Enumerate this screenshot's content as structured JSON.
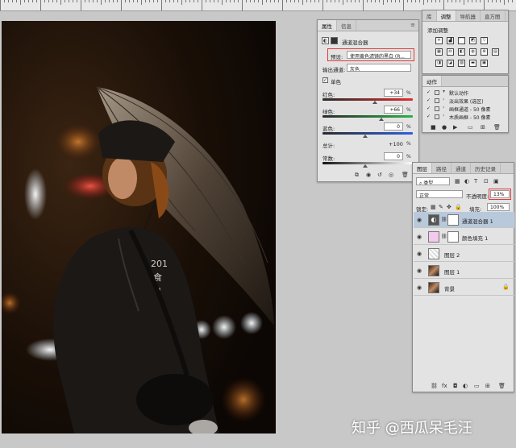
{
  "properties_panel": {
    "tabs": [
      "属性",
      "信息"
    ],
    "title": "通道混合器",
    "preset_label": "预设:",
    "preset_value": "使用黄色滤镜的黑白 (R...",
    "output_channel_label": "输出通道:",
    "output_channel_value": "灰色",
    "monochrome_label": "单色",
    "monochrome_checked": true,
    "red_label": "红色:",
    "red_value": "+34",
    "red_level": 34,
    "green_label": "绿色:",
    "green_value": "+66",
    "green_level": 66,
    "blue_label": "蓝色:",
    "blue_value": "0",
    "blue_level": 0,
    "total_label": "总计:",
    "total_value": "+100",
    "constant_label": "常数:",
    "constant_value": "0",
    "percent": "%",
    "accent_color": "#e23b3b"
  },
  "adjustments_panel": {
    "tabs": [
      "库",
      "调整",
      "导航器",
      "直方图"
    ],
    "add_label": "添加调整"
  },
  "actions_panel": {
    "tab": "动作",
    "rows": [
      {
        "label": "默认动作",
        "checked": true
      },
      {
        "label": "淡出效果 (选区)",
        "checked": true
      },
      {
        "label": "画框通道 - 50 像素",
        "checked": true
      },
      {
        "label": "木质画框 - 50 像素",
        "checked": true
      }
    ]
  },
  "layers_panel": {
    "tabs": [
      "图层",
      "路径",
      "通道",
      "历史记录"
    ],
    "kind_label": "类型",
    "blend_mode": "正常",
    "opacity_label": "不透明度:",
    "opacity_value": "13%",
    "lock_label": "锁定:",
    "fill_label": "填充:",
    "fill_value": "100%",
    "layers": [
      {
        "name": "通道混合器 1",
        "selected": true
      },
      {
        "name": "颜色填充 1",
        "selected": false
      },
      {
        "name": "图层 2",
        "selected": false
      },
      {
        "name": "图层 1",
        "selected": false
      },
      {
        "name": "背景",
        "selected": false
      }
    ]
  },
  "watermark": "知乎 @西瓜呆毛汪"
}
